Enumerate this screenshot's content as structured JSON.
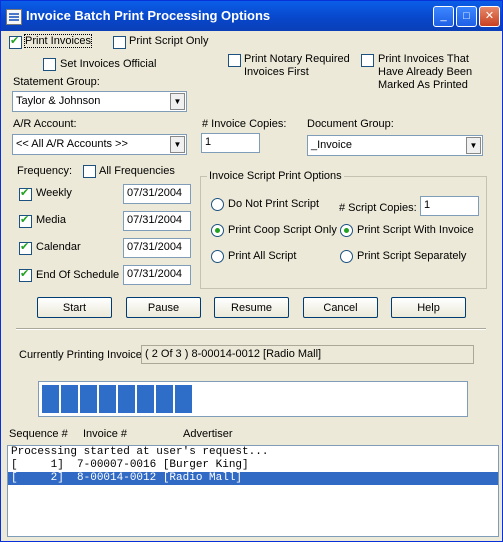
{
  "window": {
    "title": "Invoice Batch Print Processing Options"
  },
  "options": {
    "print_invoices": {
      "label": "Print Invoices",
      "checked": true
    },
    "print_script_only": {
      "label": "Print Script Only",
      "checked": false
    },
    "set_invoices_official": {
      "label": "Set Invoices Official",
      "checked": false
    },
    "print_notary_required": {
      "label_line1": "Print Notary Required",
      "label_line2": "Invoices First",
      "checked": false
    },
    "print_already_printed": {
      "label_line1": "Print Invoices That",
      "label_line2": "Have Already Been",
      "label_line3": "Marked As Printed",
      "checked": false
    }
  },
  "statement_group": {
    "label": "Statement Group:",
    "value": "Taylor & Johnson"
  },
  "ar_account": {
    "label": "A/R Account:",
    "value": "<< All A/R Accounts >>"
  },
  "invoice_copies": {
    "label": "# Invoice Copies:",
    "value": "1"
  },
  "document_group": {
    "label": "Document Group:",
    "value": "_Invoice"
  },
  "frequency": {
    "label": "Frequency:",
    "all_label": "All Frequencies",
    "items": [
      {
        "label": "Weekly",
        "date": "07/31/2004",
        "checked": true
      },
      {
        "label": "Media",
        "date": "07/31/2004",
        "checked": true
      },
      {
        "label": "Calendar",
        "date": "07/31/2004",
        "checked": true
      },
      {
        "label": "End Of Schedule",
        "date": "07/31/2004",
        "checked": true
      }
    ]
  },
  "script_options": {
    "title": "Invoice Script Print Options",
    "do_not_print": "Do Not Print Script",
    "coop_only": "Print Coop Script Only",
    "all_script": "Print All Script",
    "script_copies_label": "# Script Copies:",
    "script_copies_value": "1",
    "with_invoice": "Print Script With Invoice",
    "separately": "Print Script Separately"
  },
  "buttons": {
    "start": "Start",
    "pause": "Pause",
    "resume": "Resume",
    "cancel": "Cancel",
    "help": "Help"
  },
  "status": {
    "label": "Currently Printing Invoice:",
    "value": "( 2 Of 3 ) 8-00014-0012 [Radio Mall]"
  },
  "progress": {
    "fraction": 0.37
  },
  "list": {
    "headers": [
      "Sequence #",
      "Invoice #",
      "Advertiser"
    ],
    "rows": [
      "Processing started at user's request...",
      "[     1]  7-00007-0016 [Burger King]",
      "[     2]  8-00014-0012 [Radio Mall]"
    ]
  }
}
